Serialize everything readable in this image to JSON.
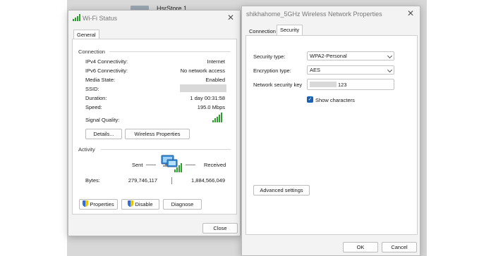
{
  "background_file_label": "HsrStore 1",
  "wifi_status": {
    "title": "Wi-Fi Status",
    "tab_general": "General",
    "connection": {
      "heading": "Connection",
      "rows": [
        {
          "label": "IPv4 Connectivity:",
          "value": "Internet"
        },
        {
          "label": "IPv6 Connectivity:",
          "value": "No network access"
        },
        {
          "label": "Media State:",
          "value": "Enabled"
        },
        {
          "label": "SSID:",
          "value": ""
        },
        {
          "label": "Duration:",
          "value": "1 day 00:31:58"
        },
        {
          "label": "Speed:",
          "value": "195.0 Mbps"
        }
      ],
      "signal_label": "Signal Quality:"
    },
    "buttons": {
      "details": "Details...",
      "wireless_properties": "Wireless Properties"
    },
    "activity": {
      "heading": "Activity",
      "sent": "Sent",
      "received": "Received",
      "bytes_label": "Bytes:",
      "bytes_sent": "279,746,117",
      "bytes_received": "1,884,566,049"
    },
    "bottom_buttons": {
      "properties": "Properties",
      "disable": "Disable",
      "diagnose": "Diagnose"
    },
    "close": "Close"
  },
  "wireless_props": {
    "title": "shikhahome_5GHz Wireless Network Properties",
    "tab_connection": "Connection",
    "tab_security": "Security",
    "security_type_label": "Security type:",
    "security_type_value": "WPA2-Personal",
    "encryption_type_label": "Encryption type:",
    "encryption_type_value": "AES",
    "network_key_label": "Network security key",
    "network_key_visible_suffix": "123",
    "show_characters": "Show characters",
    "show_characters_checked": true,
    "advanced_settings": "Advanced settings",
    "ok": "OK",
    "cancel": "Cancel"
  },
  "colors": {
    "signal_green": "#2e9c2e",
    "checkbox_blue": "#1a5fb4",
    "shield_blue": "#2f6fd6",
    "shield_yellow": "#f2c200"
  },
  "icons": {
    "wifi": "wifi-signal-icon",
    "network": "network-computers-icon",
    "shield": "uac-shield-icon"
  }
}
